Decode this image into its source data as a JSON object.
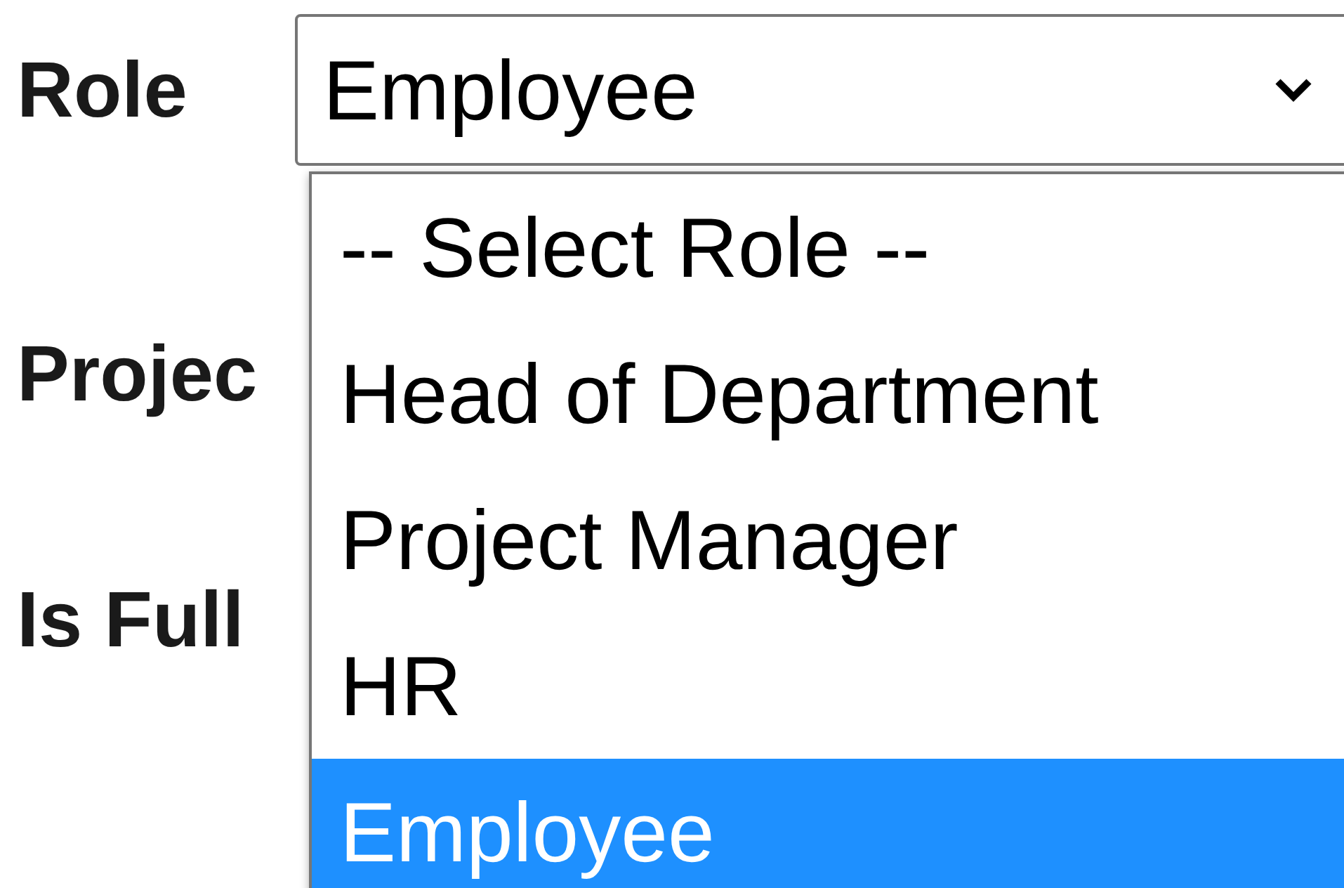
{
  "role_field": {
    "label": "Role",
    "value": "Employee"
  },
  "other_labels": [
    "Projec",
    "Is Full"
  ],
  "dropdown": {
    "options": [
      {
        "label": "-- Select Role --",
        "selected": false
      },
      {
        "label": "Head of Department",
        "selected": false
      },
      {
        "label": "Project Manager",
        "selected": false
      },
      {
        "label": "HR",
        "selected": false
      },
      {
        "label": "Employee",
        "selected": true
      }
    ]
  }
}
